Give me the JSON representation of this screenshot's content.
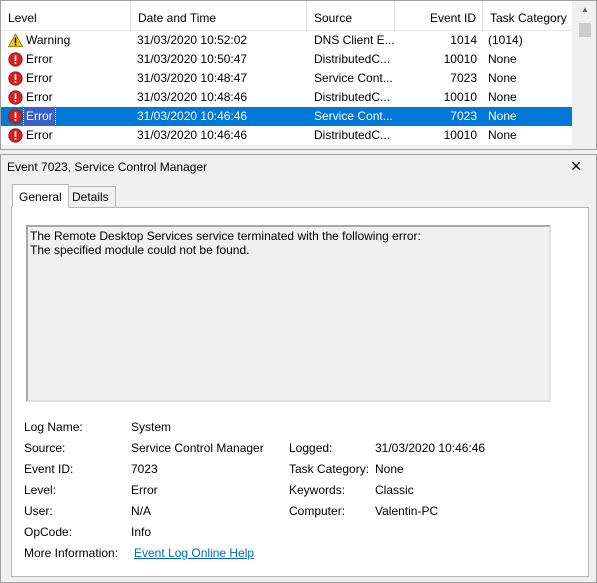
{
  "columns": {
    "level": "Level",
    "date": "Date and Time",
    "source": "Source",
    "event_id": "Event ID",
    "task": "Task Category"
  },
  "rows": [
    {
      "level": "Warning",
      "icon": "warning-icon",
      "date": "31/03/2020 10:52:02",
      "source": "DNS Client E...",
      "event_id": "1014",
      "task": "(1014)",
      "selected": false
    },
    {
      "level": "Error",
      "icon": "error-icon",
      "date": "31/03/2020 10:50:47",
      "source": "DistributedC...",
      "event_id": "10010",
      "task": "None",
      "selected": false
    },
    {
      "level": "Error",
      "icon": "error-icon",
      "date": "31/03/2020 10:48:47",
      "source": "Service Cont...",
      "event_id": "7023",
      "task": "None",
      "selected": false
    },
    {
      "level": "Error",
      "icon": "error-icon",
      "date": "31/03/2020 10:48:46",
      "source": "DistributedC...",
      "event_id": "10010",
      "task": "None",
      "selected": false
    },
    {
      "level": "Error",
      "icon": "error-icon",
      "date": "31/03/2020 10:46:46",
      "source": "Service Cont...",
      "event_id": "7023",
      "task": "None",
      "selected": true
    },
    {
      "level": "Error",
      "icon": "error-icon",
      "date": "31/03/2020 10:46:46",
      "source": "DistributedC...",
      "event_id": "10010",
      "task": "None",
      "selected": false
    }
  ],
  "detail": {
    "title": "Event 7023, Service Control Manager",
    "close": "✕",
    "tabs": {
      "general": "General",
      "details": "Details"
    },
    "description": {
      "line1": "The Remote Desktop Services service terminated with the following error:",
      "line2": "The specified module could not be found."
    },
    "labels": {
      "log_name": "Log Name:",
      "source": "Source:",
      "event_id": "Event ID:",
      "level": "Level:",
      "user": "User:",
      "opcode": "OpCode:",
      "more_info": "More Information:",
      "logged": "Logged:",
      "task_category": "Task Category:",
      "keywords": "Keywords:",
      "computer": "Computer:"
    },
    "values": {
      "log_name": "System",
      "source": "Service Control Manager",
      "event_id": "7023",
      "level": "Error",
      "user": "N/A",
      "opcode": "Info",
      "more_info": "Event Log Online Help",
      "logged": "31/03/2020 10:46:46",
      "task_category": "None",
      "keywords": "Classic",
      "computer": "Valentin-PC"
    }
  },
  "colors": {
    "selection": "#0078d7",
    "error": "#d4201e",
    "warning": "#f5c518",
    "link": "#0066cc"
  }
}
